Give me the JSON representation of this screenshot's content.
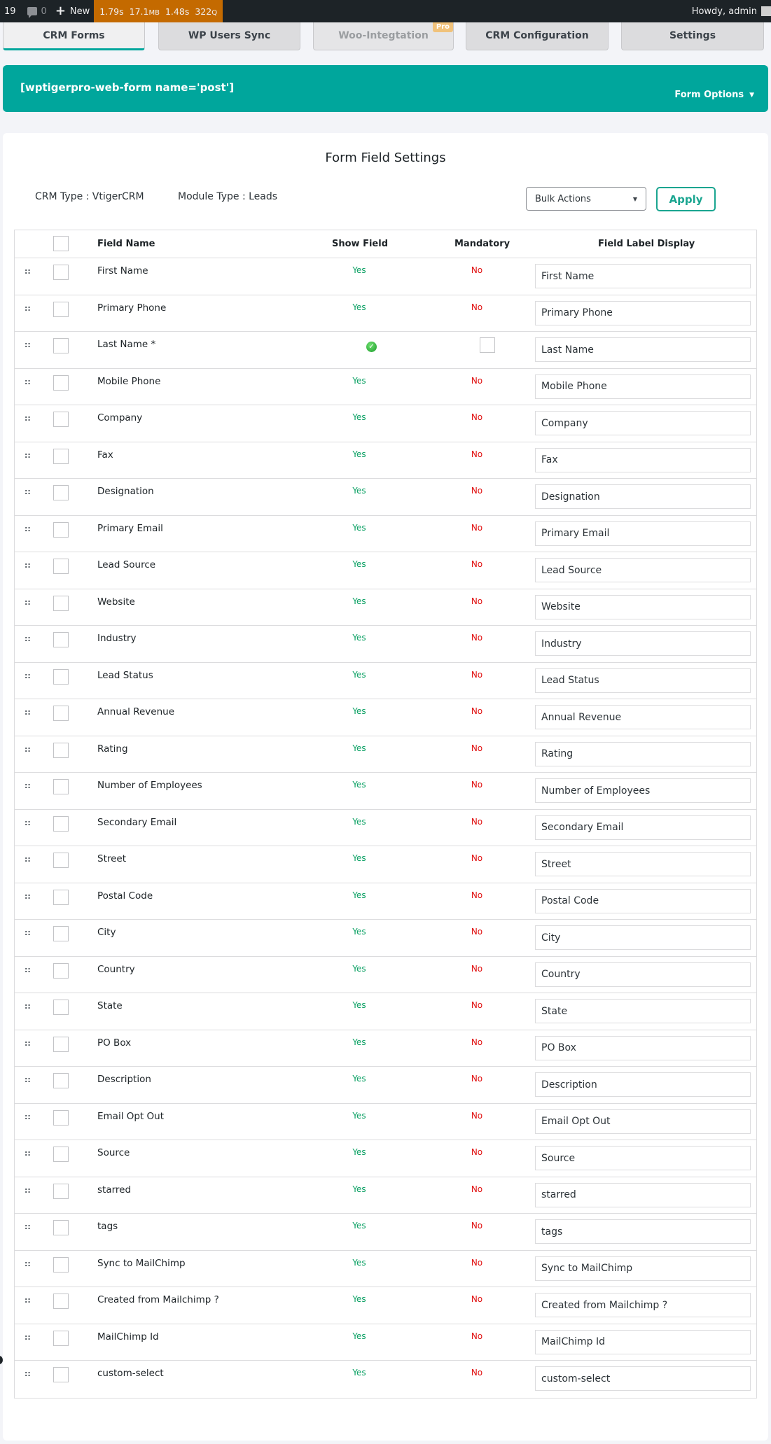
{
  "adminbar": {
    "count": "19",
    "comments": "0",
    "new_label": "New",
    "query_monitor": {
      "time": "1.79s",
      "memory": "17.1",
      "memory_unit": "MB",
      "db_time": "1.48s",
      "queries": "322",
      "queries_unit": "Q"
    },
    "greeting": "Howdy, admin"
  },
  "tabs": [
    {
      "label": "CRM Forms",
      "state": "active"
    },
    {
      "label": "WP Users Sync",
      "state": "normal"
    },
    {
      "label": "Woo-Integtation",
      "state": "disabled",
      "badge": "Pro"
    },
    {
      "label": "CRM Configuration",
      "state": "normal"
    },
    {
      "label": "Settings",
      "state": "normal"
    }
  ],
  "banner": {
    "shortcode": "[wptigerpro-web-form name='post']",
    "options_label": "Form Options",
    "color": "#00a69c"
  },
  "card": {
    "title": "Form Field Settings",
    "crm_type": "CRM Type : VtigerCRM",
    "module_type": "Module Type : Leads",
    "bulk_actions": "Bulk Actions",
    "apply_label": "Apply"
  },
  "table": {
    "headers": {
      "field_name": "Field Name",
      "show_field": "Show Field",
      "mandatory": "Mandatory",
      "label_display": "Field Label Display"
    },
    "drag_handle": "::",
    "rows": [
      {
        "name": "First Name",
        "show": "Yes",
        "mandatory": "No",
        "label": "First Name"
      },
      {
        "name": "Primary Phone",
        "show": "Yes",
        "mandatory": "No",
        "label": "Primary Phone"
      },
      {
        "name": "Last Name *",
        "show": "check-icon",
        "mandatory": "checkbox",
        "label": "Last Name"
      },
      {
        "name": "Mobile Phone",
        "show": "Yes",
        "mandatory": "No",
        "label": "Mobile Phone"
      },
      {
        "name": "Company",
        "show": "Yes",
        "mandatory": "No",
        "label": "Company"
      },
      {
        "name": "Fax",
        "show": "Yes",
        "mandatory": "No",
        "label": "Fax"
      },
      {
        "name": "Designation",
        "show": "Yes",
        "mandatory": "No",
        "label": "Designation"
      },
      {
        "name": "Primary Email",
        "show": "Yes",
        "mandatory": "No",
        "label": "Primary Email"
      },
      {
        "name": "Lead Source",
        "show": "Yes",
        "mandatory": "No",
        "label": "Lead Source"
      },
      {
        "name": "Website",
        "show": "Yes",
        "mandatory": "No",
        "label": "Website"
      },
      {
        "name": "Industry",
        "show": "Yes",
        "mandatory": "No",
        "label": "Industry"
      },
      {
        "name": "Lead Status",
        "show": "Yes",
        "mandatory": "No",
        "label": "Lead Status"
      },
      {
        "name": "Annual Revenue",
        "show": "Yes",
        "mandatory": "No",
        "label": "Annual Revenue"
      },
      {
        "name": "Rating",
        "show": "Yes",
        "mandatory": "No",
        "label": "Rating"
      },
      {
        "name": "Number of Employees",
        "show": "Yes",
        "mandatory": "No",
        "label": "Number of Employees"
      },
      {
        "name": "Secondary Email",
        "show": "Yes",
        "mandatory": "No",
        "label": "Secondary Email"
      },
      {
        "name": "Street",
        "show": "Yes",
        "mandatory": "No",
        "label": "Street"
      },
      {
        "name": "Postal Code",
        "show": "Yes",
        "mandatory": "No",
        "label": "Postal Code"
      },
      {
        "name": "City",
        "show": "Yes",
        "mandatory": "No",
        "label": "City"
      },
      {
        "name": "Country",
        "show": "Yes",
        "mandatory": "No",
        "label": "Country"
      },
      {
        "name": "State",
        "show": "Yes",
        "mandatory": "No",
        "label": "State"
      },
      {
        "name": "PO Box",
        "show": "Yes",
        "mandatory": "No",
        "label": "PO Box"
      },
      {
        "name": "Description",
        "show": "Yes",
        "mandatory": "No",
        "label": "Description"
      },
      {
        "name": "Email Opt Out",
        "show": "Yes",
        "mandatory": "No",
        "label": "Email Opt Out"
      },
      {
        "name": "Source",
        "show": "Yes",
        "mandatory": "No",
        "label": "Source"
      },
      {
        "name": "starred",
        "show": "Yes",
        "mandatory": "No",
        "label": "starred"
      },
      {
        "name": "tags",
        "show": "Yes",
        "mandatory": "No",
        "label": "tags"
      },
      {
        "name": "Sync to MailChimp",
        "show": "Yes",
        "mandatory": "No",
        "label": "Sync to MailChimp"
      },
      {
        "name": "Created from Mailchimp ?",
        "show": "Yes",
        "mandatory": "No",
        "label": "Created from Mailchimp ?"
      },
      {
        "name": "MailChimp Id",
        "show": "Yes",
        "mandatory": "No",
        "label": "MailChimp Id"
      },
      {
        "name": "custom-select",
        "show": "Yes",
        "mandatory": "No",
        "label": "custom-select"
      }
    ]
  },
  "colors": {
    "accent": "#00a69c",
    "yes": "#0aa063",
    "no": "#e00e0e",
    "adminbar": "#1d2327",
    "query_monitor": "#c46a00"
  }
}
